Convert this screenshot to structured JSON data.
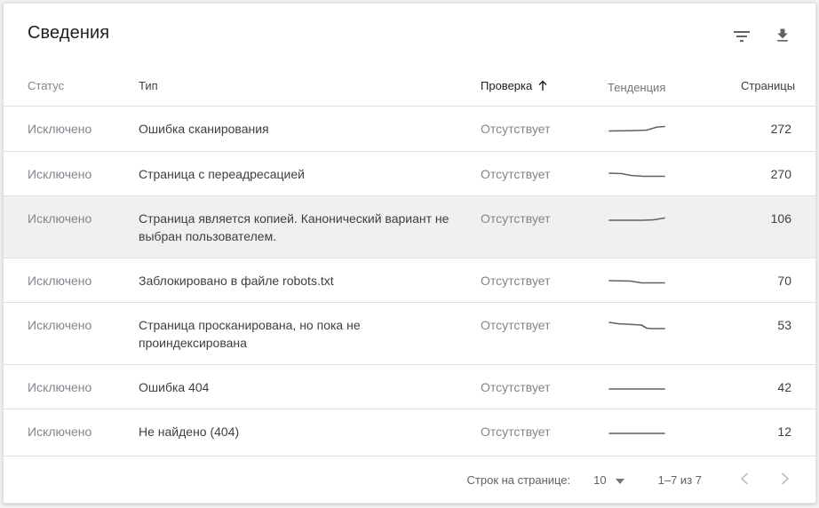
{
  "header": {
    "title": "Сведения",
    "filter_icon": "filter-icon",
    "download_icon": "download-icon"
  },
  "table": {
    "columns": [
      {
        "label": "Статус",
        "sorted": false
      },
      {
        "label": "Тип",
        "sorted": false
      },
      {
        "label": "Проверка",
        "sorted": true,
        "sort_direction": "ascending"
      },
      {
        "label": "Тенденция",
        "sorted": false
      },
      {
        "label": "Страницы",
        "sorted": false
      }
    ],
    "rows": [
      {
        "status": "Исключено",
        "type": "Ошибка сканирования",
        "validation": "Отсутствует",
        "pages": "272",
        "highlighted": false,
        "trend": [
          [
            2,
            9.5
          ],
          [
            30,
            9
          ],
          [
            44,
            8.5
          ],
          [
            56,
            5
          ],
          [
            64,
            4.5
          ]
        ]
      },
      {
        "status": "Исключено",
        "type": "Страница с переадресацией",
        "validation": "Отсутствует",
        "pages": "270",
        "highlighted": false,
        "trend": [
          [
            2,
            6
          ],
          [
            16,
            6.5
          ],
          [
            26,
            8.5
          ],
          [
            40,
            9.5
          ],
          [
            64,
            9.5
          ]
        ]
      },
      {
        "status": "Исключено",
        "type": "Страница является копией. Канонический вариант не выбран пользователем.",
        "validation": "Отсутствует",
        "pages": "106",
        "highlighted": true,
        "trend": [
          [
            2,
            9
          ],
          [
            40,
            9
          ],
          [
            52,
            8.5
          ],
          [
            64,
            6.5
          ]
        ]
      },
      {
        "status": "Исключено",
        "type": "Заблокировано в файле robots.txt",
        "validation": "Отсутствует",
        "pages": "70",
        "highlighted": false,
        "trend": [
          [
            2,
            7
          ],
          [
            26,
            7.5
          ],
          [
            38,
            9.5
          ],
          [
            64,
            9.5
          ]
        ]
      },
      {
        "status": "Исключено",
        "type": "Страница просканирована, но пока не проиндексирована",
        "validation": "Отсутствует",
        "pages": "53",
        "highlighted": false,
        "trend": [
          [
            2,
            4
          ],
          [
            12,
            5.5
          ],
          [
            30,
            6.5
          ],
          [
            38,
            7
          ],
          [
            44,
            10.5
          ],
          [
            50,
            11
          ],
          [
            64,
            11
          ]
        ]
      },
      {
        "status": "Исключено",
        "type": "Ошибка 404",
        "validation": "Отсутствует",
        "pages": "42",
        "highlighted": false,
        "trend": [
          [
            2,
            9
          ],
          [
            64,
            9
          ]
        ]
      },
      {
        "status": "Исключено",
        "type": "Не найдено (404)",
        "validation": "Отсутствует",
        "pages": "12",
        "highlighted": false,
        "trend": [
          [
            2,
            9
          ],
          [
            64,
            9
          ]
        ]
      }
    ]
  },
  "footer": {
    "rows_per_page_label": "Строк на странице:",
    "rows_per_page_value": "10",
    "range_label": "1–7 из 7"
  },
  "colors": {
    "sparkline": "#616161",
    "icon": "#5f6368",
    "divider": "#e0e0e0",
    "row_highlight": "#f0f0f0",
    "text_primary": "#3c4043",
    "text_secondary": "#80868b",
    "nav_disabled": "#bdbdbd"
  }
}
